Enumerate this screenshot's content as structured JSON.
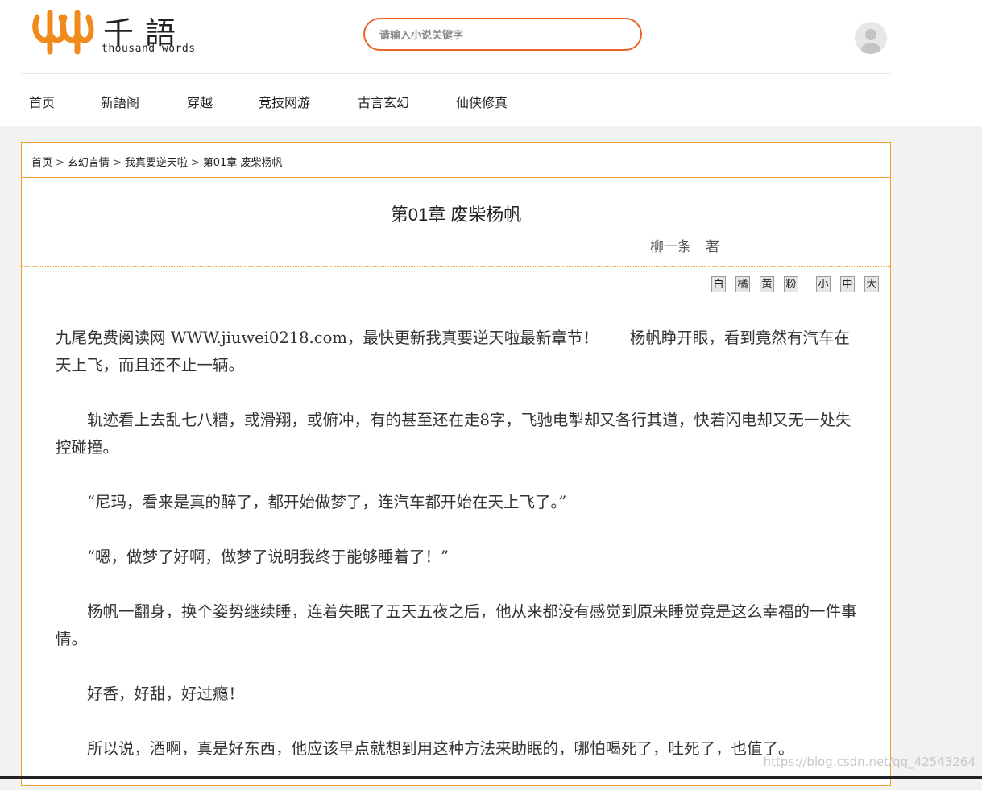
{
  "logo": {
    "cn": "千語",
    "en": "thousand words",
    "brand_color": "#f08a1c"
  },
  "search": {
    "placeholder": "请输入小说关键字",
    "accent_color": "#e8642d"
  },
  "user": {
    "icon": "user-avatar-icon"
  },
  "nav": {
    "items": [
      "首页",
      "新語阁",
      "穿越",
      "竞技网游",
      "古言玄幻",
      "仙侠修真"
    ]
  },
  "breadcrumb": {
    "items": [
      "首页",
      "玄幻言情",
      "我真要逆天啦",
      "第01章 废柴杨帆"
    ],
    "separator": ">"
  },
  "chapter": {
    "title": "第01章 废柴杨帆",
    "author_name": "柳一条",
    "author_suffix": "著"
  },
  "reader_controls": {
    "themes": [
      "白",
      "橘",
      "黄",
      "粉"
    ],
    "sizes": [
      "小",
      "中",
      "大"
    ]
  },
  "content": {
    "paragraphs": [
      "九尾免费阅读网 WWW.jiuwei0218.com，最快更新我真要逆天啦最新章节！　　杨帆睁开眼，看到竟然有汽车在天上飞，而且还不止一辆。",
      "　　轨迹看上去乱七八糟，或滑翔，或俯冲，有的甚至还在走8字，飞驰电掣却又各行其道，快若闪电却又无一处失控碰撞。",
      "　　“尼玛，看来是真的醉了，都开始做梦了，连汽车都开始在天上飞了。”",
      "　　“嗯，做梦了好啊，做梦了说明我终于能够睡着了！”",
      "　　杨帆一翻身，换个姿势继续睡，连着失眠了五天五夜之后，他从来都没有感觉到原来睡觉竟是这么幸福的一件事情。",
      "　　好香，好甜，好过瘾！",
      "　　所以说，酒啊，真是好东西，他应该早点就想到用这种方法来助眠的，哪怕喝死了，吐死了，也值了。"
    ]
  },
  "watermark": "https://blog.csdn.net/qq_42543264"
}
